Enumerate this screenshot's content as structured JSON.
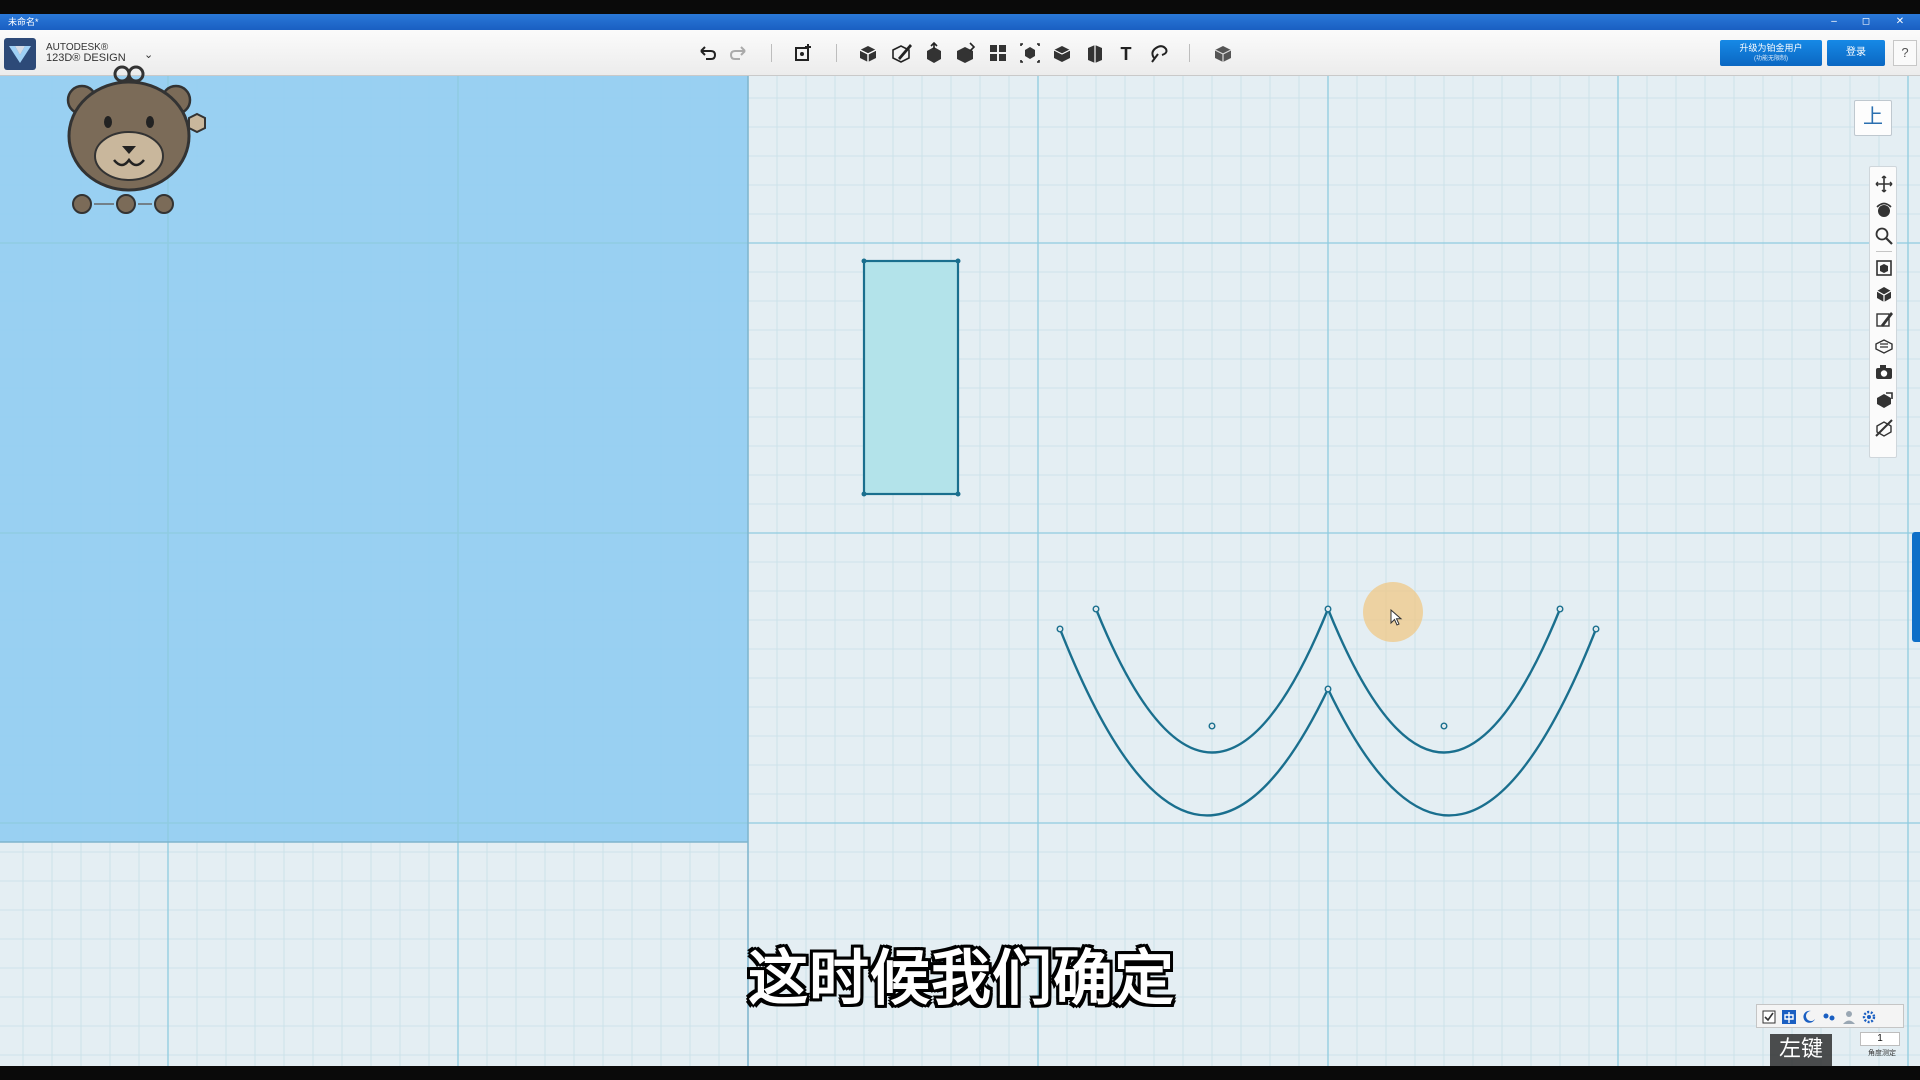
{
  "window": {
    "title": "未命名*",
    "controls": {
      "minimize": "–",
      "maximize": "◻",
      "close": "✕"
    }
  },
  "app": {
    "brand_line1": "AUTODESK®",
    "brand_line2": "123D® DESIGN",
    "brand_menu": "⌄"
  },
  "toolbar": {
    "undo_icon": "undo-icon",
    "redo_icon": "redo-icon",
    "tools": [
      "transform",
      "primitives",
      "sketch",
      "construct",
      "modify",
      "pattern",
      "grouping",
      "combine",
      "measure",
      "text",
      "snap",
      "material"
    ],
    "text_tool_label": "T"
  },
  "account": {
    "upgrade_label": "升级为铂金用户",
    "upgrade_sub": "(功能无限制)",
    "login_label": "登录",
    "help_label": "?"
  },
  "viewcube": {
    "face_label": "上"
  },
  "nav": [
    "pan",
    "orbit",
    "zoom",
    "fit",
    "views",
    "edit-grid",
    "materials",
    "snapshot",
    "layers",
    "outliner"
  ],
  "subtitle": "这时候我们确定",
  "mini_panel": {
    "input_value": "1",
    "caption": "角度测定"
  },
  "key_hint": "左键",
  "colors": {
    "accent": "#0b67c2",
    "sketch_line": "#1a6f8e",
    "grid_major": "#8fcbe0",
    "grid_minor": "#c7dfe8",
    "canvas": "#e4eef3",
    "selection_plane": "#93cdf2"
  }
}
